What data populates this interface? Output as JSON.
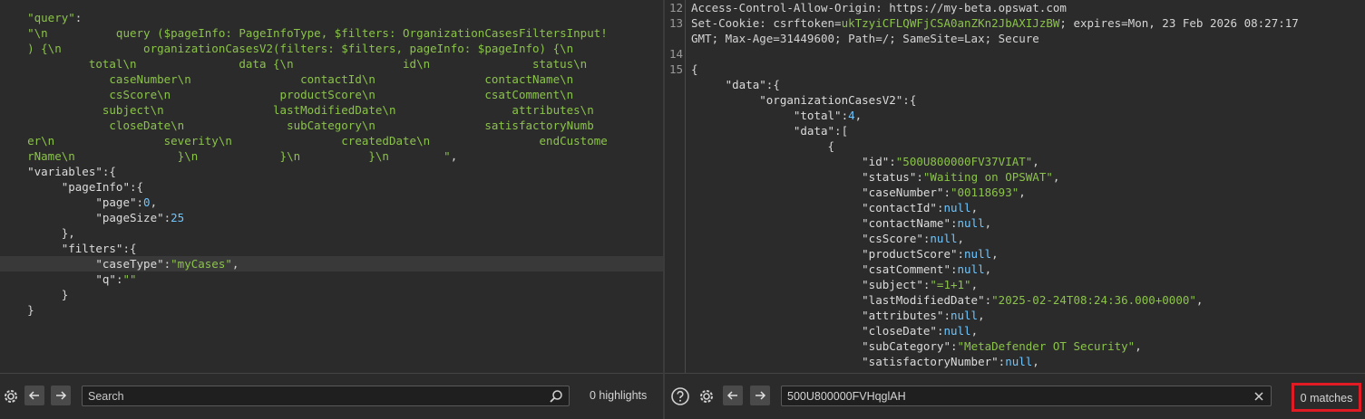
{
  "left": {
    "lines": [
      [
        {
          "t": "    \"query\"",
          "c": "tok-str"
        },
        {
          "t": ":",
          "c": "tok-punct"
        }
      ],
      [
        {
          "t": "    \"\\n          query ($pageInfo: PageInfoType, $filters: OrganizationCasesFiltersInput!",
          "c": "tok-str"
        }
      ],
      [
        {
          "t": "    ) {\\n            organizationCasesV2(filters: $filters, pageInfo: $pageInfo) {\\n",
          "c": "tok-str"
        }
      ],
      [
        {
          "t": "             total\\n               data {\\n                id\\n               status\\n",
          "c": "tok-str"
        }
      ],
      [
        {
          "t": "                caseNumber\\n                contactId\\n                contactName\\n",
          "c": "tok-str"
        }
      ],
      [
        {
          "t": "                csScore\\n                productScore\\n                csatComment\\n",
          "c": "tok-str"
        }
      ],
      [
        {
          "t": "               subject\\n                lastModifiedDate\\n                 attributes\\n",
          "c": "tok-str"
        }
      ],
      [
        {
          "t": "                closeDate\\n               subCategory\\n                satisfactoryNumb",
          "c": "tok-str"
        }
      ],
      [
        {
          "t": "    er\\n                severity\\n                createdDate\\n                endCustome",
          "c": "tok-str"
        }
      ],
      [
        {
          "t": "    rName\\n               }\\n            }\\n          }\\n        \"",
          "c": "tok-str"
        },
        {
          "t": ",",
          "c": "tok-punct"
        }
      ],
      [
        {
          "t": "    \"variables\"",
          "c": "tok-key"
        },
        {
          "t": ":{",
          "c": "tok-punct"
        }
      ],
      [
        {
          "t": "         \"pageInfo\"",
          "c": "tok-key"
        },
        {
          "t": ":{",
          "c": "tok-punct"
        }
      ],
      [
        {
          "t": "              \"page\"",
          "c": "tok-key"
        },
        {
          "t": ":",
          "c": "tok-punct"
        },
        {
          "t": "0",
          "c": "tok-num"
        },
        {
          "t": ",",
          "c": "tok-punct"
        }
      ],
      [
        {
          "t": "              \"pageSize\"",
          "c": "tok-key"
        },
        {
          "t": ":",
          "c": "tok-punct"
        },
        {
          "t": "25",
          "c": "tok-num"
        }
      ],
      [
        {
          "t": "         },",
          "c": "tok-punct"
        }
      ],
      [
        {
          "t": "         \"filters\"",
          "c": "tok-key"
        },
        {
          "t": ":{",
          "c": "tok-punct"
        }
      ],
      [
        {
          "t": "              \"caseType\"",
          "c": "tok-key"
        },
        {
          "t": ":",
          "c": "tok-punct"
        },
        {
          "t": "\"myCases\"",
          "c": "tok-str"
        },
        {
          "t": ",",
          "c": "tok-punct"
        }
      ],
      [
        {
          "t": "              \"q\"",
          "c": "tok-key"
        },
        {
          "t": ":",
          "c": "tok-punct"
        },
        {
          "t": "\"\"",
          "c": "tok-str"
        }
      ],
      [
        {
          "t": "         }",
          "c": "tok-punct"
        }
      ],
      [
        {
          "t": "    }",
          "c": "tok-punct"
        }
      ]
    ],
    "highlighted_line": 16,
    "footer": {
      "search_placeholder": "Search",
      "count": "0 highlights"
    }
  },
  "right": {
    "lines": [
      {
        "n": "12",
        "toks": [
          {
            "t": "Access-Control-Allow-Origin: https://my-beta.opswat.com",
            "c": "tok-plain"
          }
        ]
      },
      {
        "n": "13",
        "toks": [
          {
            "t": "Set-Cookie: ",
            "c": "tok-plain"
          },
          {
            "t": "csrftoken",
            "c": "tok-cookie"
          },
          {
            "t": "=",
            "c": "tok-plain"
          },
          {
            "t": "ukTzyiCFLQWFjCSA0anZKn2JbAXIJzBW",
            "c": "tok-cookieval"
          },
          {
            "t": "; expires=Mon, 23 Feb 2026 08:27:17",
            "c": "tok-plain"
          }
        ]
      },
      {
        "n": "",
        "toks": [
          {
            "t": "GMT; Max-Age=31449600; Path=/; SameSite=Lax; Secure",
            "c": "tok-plain"
          }
        ]
      },
      {
        "n": "14",
        "toks": []
      },
      {
        "n": "15",
        "toks": [
          {
            "t": "{",
            "c": "tok-punct"
          }
        ]
      },
      {
        "n": "",
        "toks": [
          {
            "t": "     \"data\"",
            "c": "tok-key"
          },
          {
            "t": ":{",
            "c": "tok-punct"
          }
        ]
      },
      {
        "n": "",
        "toks": [
          {
            "t": "          \"organizationCasesV2\"",
            "c": "tok-key"
          },
          {
            "t": ":{",
            "c": "tok-punct"
          }
        ]
      },
      {
        "n": "",
        "toks": [
          {
            "t": "               \"total\"",
            "c": "tok-key"
          },
          {
            "t": ":",
            "c": "tok-punct"
          },
          {
            "t": "4",
            "c": "tok-num"
          },
          {
            "t": ",",
            "c": "tok-punct"
          }
        ]
      },
      {
        "n": "",
        "toks": [
          {
            "t": "               \"data\"",
            "c": "tok-key"
          },
          {
            "t": ":[",
            "c": "tok-punct"
          }
        ]
      },
      {
        "n": "",
        "toks": [
          {
            "t": "                    {",
            "c": "tok-punct"
          }
        ]
      },
      {
        "n": "",
        "toks": [
          {
            "t": "                         \"id\"",
            "c": "tok-key"
          },
          {
            "t": ":",
            "c": "tok-punct"
          },
          {
            "t": "\"500U800000FV37VIAT\"",
            "c": "tok-str"
          },
          {
            "t": ",",
            "c": "tok-punct"
          }
        ]
      },
      {
        "n": "",
        "toks": [
          {
            "t": "                         \"status\"",
            "c": "tok-key"
          },
          {
            "t": ":",
            "c": "tok-punct"
          },
          {
            "t": "\"Waiting on OPSWAT\"",
            "c": "tok-str"
          },
          {
            "t": ",",
            "c": "tok-punct"
          }
        ]
      },
      {
        "n": "",
        "toks": [
          {
            "t": "                         \"caseNumber\"",
            "c": "tok-key"
          },
          {
            "t": ":",
            "c": "tok-punct"
          },
          {
            "t": "\"00118693\"",
            "c": "tok-str"
          },
          {
            "t": ",",
            "c": "tok-punct"
          }
        ]
      },
      {
        "n": "",
        "toks": [
          {
            "t": "                         \"contactId\"",
            "c": "tok-key"
          },
          {
            "t": ":",
            "c": "tok-punct"
          },
          {
            "t": "null",
            "c": "tok-null"
          },
          {
            "t": ",",
            "c": "tok-punct"
          }
        ]
      },
      {
        "n": "",
        "toks": [
          {
            "t": "                         \"contactName\"",
            "c": "tok-key"
          },
          {
            "t": ":",
            "c": "tok-punct"
          },
          {
            "t": "null",
            "c": "tok-null"
          },
          {
            "t": ",",
            "c": "tok-punct"
          }
        ]
      },
      {
        "n": "",
        "toks": [
          {
            "t": "                         \"csScore\"",
            "c": "tok-key"
          },
          {
            "t": ":",
            "c": "tok-punct"
          },
          {
            "t": "null",
            "c": "tok-null"
          },
          {
            "t": ",",
            "c": "tok-punct"
          }
        ]
      },
      {
        "n": "",
        "toks": [
          {
            "t": "                         \"productScore\"",
            "c": "tok-key"
          },
          {
            "t": ":",
            "c": "tok-punct"
          },
          {
            "t": "null",
            "c": "tok-null"
          },
          {
            "t": ",",
            "c": "tok-punct"
          }
        ]
      },
      {
        "n": "",
        "toks": [
          {
            "t": "                         \"csatComment\"",
            "c": "tok-key"
          },
          {
            "t": ":",
            "c": "tok-punct"
          },
          {
            "t": "null",
            "c": "tok-null"
          },
          {
            "t": ",",
            "c": "tok-punct"
          }
        ]
      },
      {
        "n": "",
        "toks": [
          {
            "t": "                         \"subject\"",
            "c": "tok-key"
          },
          {
            "t": ":",
            "c": "tok-punct"
          },
          {
            "t": "\"=1+1\"",
            "c": "tok-str"
          },
          {
            "t": ",",
            "c": "tok-punct"
          }
        ]
      },
      {
        "n": "",
        "toks": [
          {
            "t": "                         \"lastModifiedDate\"",
            "c": "tok-key"
          },
          {
            "t": ":",
            "c": "tok-punct"
          },
          {
            "t": "\"2025-02-24T08:24:36.000+0000\"",
            "c": "tok-str"
          },
          {
            "t": ",",
            "c": "tok-punct"
          }
        ]
      },
      {
        "n": "",
        "toks": [
          {
            "t": "                         \"attributes\"",
            "c": "tok-key"
          },
          {
            "t": ":",
            "c": "tok-punct"
          },
          {
            "t": "null",
            "c": "tok-null"
          },
          {
            "t": ",",
            "c": "tok-punct"
          }
        ]
      },
      {
        "n": "",
        "toks": [
          {
            "t": "                         \"closeDate\"",
            "c": "tok-key"
          },
          {
            "t": ":",
            "c": "tok-punct"
          },
          {
            "t": "null",
            "c": "tok-null"
          },
          {
            "t": ",",
            "c": "tok-punct"
          }
        ]
      },
      {
        "n": "",
        "toks": [
          {
            "t": "                         \"subCategory\"",
            "c": "tok-key"
          },
          {
            "t": ":",
            "c": "tok-punct"
          },
          {
            "t": "\"MetaDefender OT Security\"",
            "c": "tok-str"
          },
          {
            "t": ",",
            "c": "tok-punct"
          }
        ]
      },
      {
        "n": "",
        "toks": [
          {
            "t": "                         \"satisfactoryNumber\"",
            "c": "tok-key"
          },
          {
            "t": ":",
            "c": "tok-punct"
          },
          {
            "t": "null",
            "c": "tok-null"
          },
          {
            "t": ",",
            "c": "tok-punct"
          }
        ]
      }
    ],
    "footer": {
      "search_value": "500U800000FVHqglAH",
      "count": "0 matches"
    }
  },
  "icons": {
    "settings": "gear-icon",
    "help": "question-icon",
    "prev": "arrow-left-icon",
    "next": "arrow-right-icon",
    "search": "magnifier-icon",
    "clear": "close-icon"
  }
}
